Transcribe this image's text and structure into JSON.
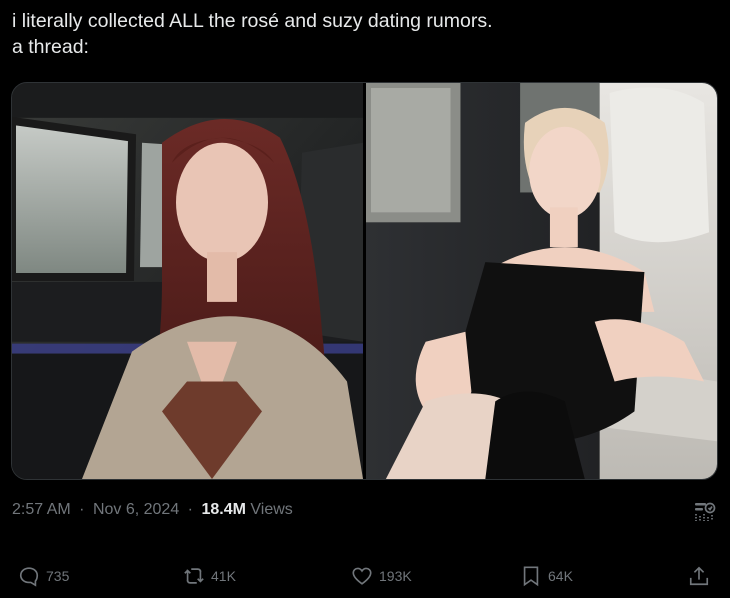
{
  "tweet": {
    "text_line1": "i literally collected ALL the rosé and suzy dating rumors.",
    "text_line2": "a thread:"
  },
  "meta": {
    "time": "2:57 AM",
    "date": "Nov 6, 2024",
    "views_count": "18.4M",
    "views_label": "Views",
    "separator": "·"
  },
  "actions": {
    "replies": "735",
    "reposts": "41K",
    "likes": "193K",
    "bookmarks": "64K"
  },
  "icons": {
    "reply": "speech-bubble-icon",
    "repost": "repost-arrows-icon",
    "like": "heart-icon",
    "bookmark": "bookmark-icon",
    "share": "share-upload-icon",
    "analytics": "grok-analytics-icon"
  },
  "colors": {
    "background": "#000000",
    "text_primary": "#e7e9ea",
    "text_secondary": "#71767b",
    "border": "#2f3336"
  }
}
